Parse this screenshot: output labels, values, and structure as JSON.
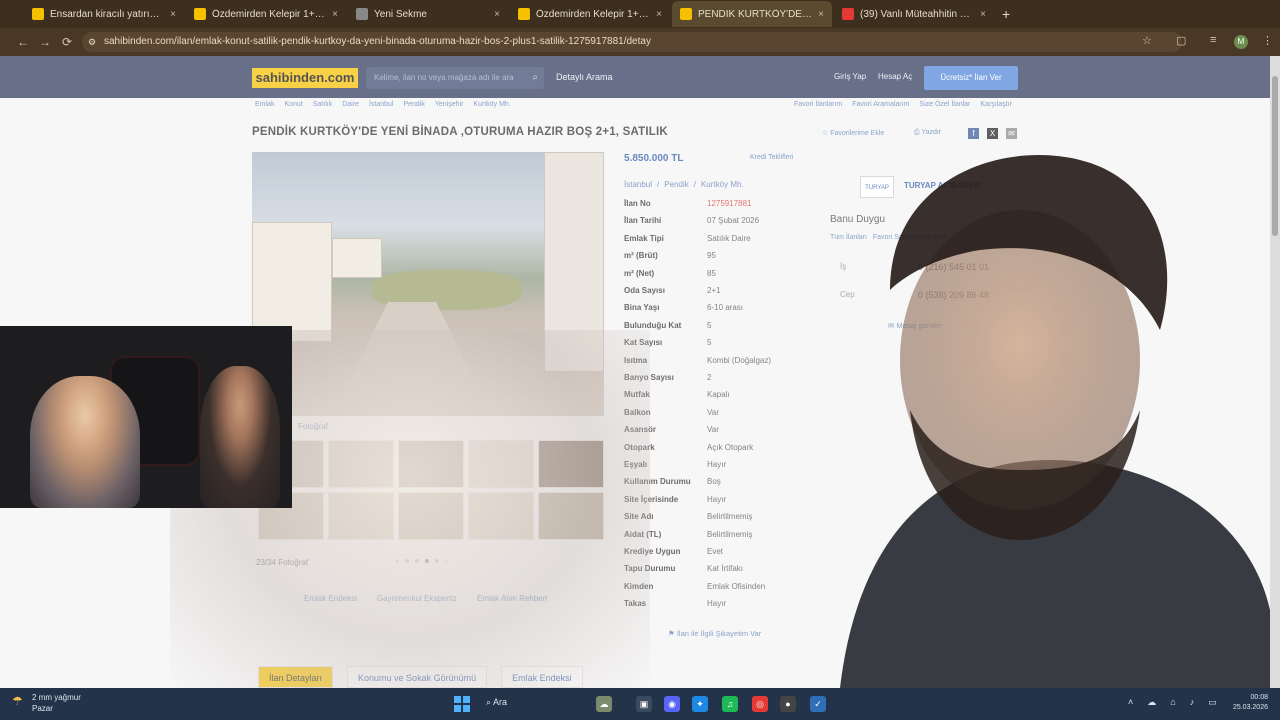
{
  "browser": {
    "tabs": [
      {
        "title": "Ensardan kiracılı yatırımlık fırsa",
        "fav_color": "#f6c000"
      },
      {
        "title": "Özdemirden Kelepir 1+0 Stüd",
        "fav_color": "#f6c000"
      },
      {
        "title": "Yeni Sekme",
        "fav_color": "#888888"
      },
      {
        "title": "Özdemirden Kelepir 1+0 Stüd",
        "fav_color": "#f6c000"
      },
      {
        "title": "PENDİK KURTKÖY'DE YENİ Bİ",
        "fav_color": "#f6c000"
      },
      {
        "title": "(39) Vanlı Müteahhitin Beyin",
        "fav_color": "#e53935"
      }
    ],
    "url": "sahibinden.com/ilan/emlak-konut-satilik-pendik-kurtkoy-da-yeni-binada-oturuma-hazir-bos-2-plus1-satilik-1275917881/detay",
    "profile_initial": "M"
  },
  "site": {
    "logo": "sahibinden.com",
    "search_placeholder": "Kelime, ilan no veya mağaza adı ile ara",
    "detailed_search": "Detaylı Arama",
    "login": "Giriş Yap",
    "register": "Hesap Aç",
    "post_ad": "Ücretsiz* İlan Ver",
    "brand_color": "#f6c000",
    "header_color": "#2f3a5c"
  },
  "breadcrumbs": [
    "Emlak",
    "Konut",
    "Satılık",
    "Daire",
    "İstanbul",
    "Pendik",
    "Yenişehir",
    "Kurtköy Mh."
  ],
  "breadcrumbs_right": [
    "Favori İlanlarım",
    "Favori Aramalarım",
    "Size Özel İlanlar",
    "Karşılaştır"
  ],
  "listing": {
    "title": "PENDİK KURTKÖY'DE YENİ BİNADA ,OTURUMA HAZIR BOŞ 2+1, SATILIK",
    "favorite": "Favorilerime Ekle",
    "print": "Yazdır",
    "price": "5.850.000 TL",
    "credit": "Kredi Teklifleri",
    "location": [
      "İstanbul",
      "/",
      "Pendik",
      "/",
      "Kurtköy Mh."
    ],
    "photo_tab": "Fotoğraf",
    "photo_count": "23/34 Fotoğraf",
    "links": [
      "Emlak Endeksi",
      "Gayrimenkul Ekspertiz",
      "Emlak Alım Rehberi"
    ],
    "complaint": "İlan ile İlgili Şikayetim Var",
    "features": [
      {
        "k": "İlan No",
        "v": "1275917881"
      },
      {
        "k": "İlan Tarihi",
        "v": "07 Şubat 2026"
      },
      {
        "k": "Emlak Tipi",
        "v": "Satılık Daire"
      },
      {
        "k": "m² (Brüt)",
        "v": "95"
      },
      {
        "k": "m² (Net)",
        "v": "85"
      },
      {
        "k": "Oda Sayısı",
        "v": "2+1"
      },
      {
        "k": "Bina Yaşı",
        "v": "6-10 arası"
      },
      {
        "k": "Bulunduğu Kat",
        "v": "5"
      },
      {
        "k": "Kat Sayısı",
        "v": "5"
      },
      {
        "k": "Isıtma",
        "v": "Kombi (Doğalgaz)"
      },
      {
        "k": "Banyo Sayısı",
        "v": "2"
      },
      {
        "k": "Mutfak",
        "v": "Kapalı"
      },
      {
        "k": "Balkon",
        "v": "Var"
      },
      {
        "k": "Asansör",
        "v": "Var"
      },
      {
        "k": "Otopark",
        "v": "Açık Otopark"
      },
      {
        "k": "Eşyalı",
        "v": "Hayır"
      },
      {
        "k": "Kullanım Durumu",
        "v": "Boş"
      },
      {
        "k": "Site İçerisinde",
        "v": "Hayır"
      },
      {
        "k": "Site Adı",
        "v": "Belirtilmemiş"
      },
      {
        "k": "Aidat (TL)",
        "v": "Belirtilmemiş"
      },
      {
        "k": "Krediye Uygun",
        "v": "Evet"
      },
      {
        "k": "Tapu Durumu",
        "v": "Kat İrtifakı"
      },
      {
        "k": "Kimden",
        "v": "Emlak Ofisinden"
      },
      {
        "k": "Takas",
        "v": "Hayır"
      }
    ]
  },
  "seller": {
    "agency_logo": "TURYAP",
    "agency": "TURYAP ACIBADEM",
    "agent": "Banu Duygu",
    "all_ads": "Tüm İlanları",
    "add_favorite": "Favori Satıcılarıma ekle",
    "phone1_label": "İş",
    "phone1": "0 (216) 545 01 01",
    "phone2_label": "Cep",
    "phone2": "0 (538) 209 86 48",
    "message": "Mesaj gönder"
  },
  "bottom_tabs": [
    "İlan Detayları",
    "Konumu ve Sokak Görünümü",
    "Emlak Endeksi"
  ],
  "taskbar": {
    "weather_line1": "2 mm yağmur",
    "weather_line2": "Pazar",
    "search": "Ara",
    "time": "00:08",
    "date": "25.03.2026"
  }
}
